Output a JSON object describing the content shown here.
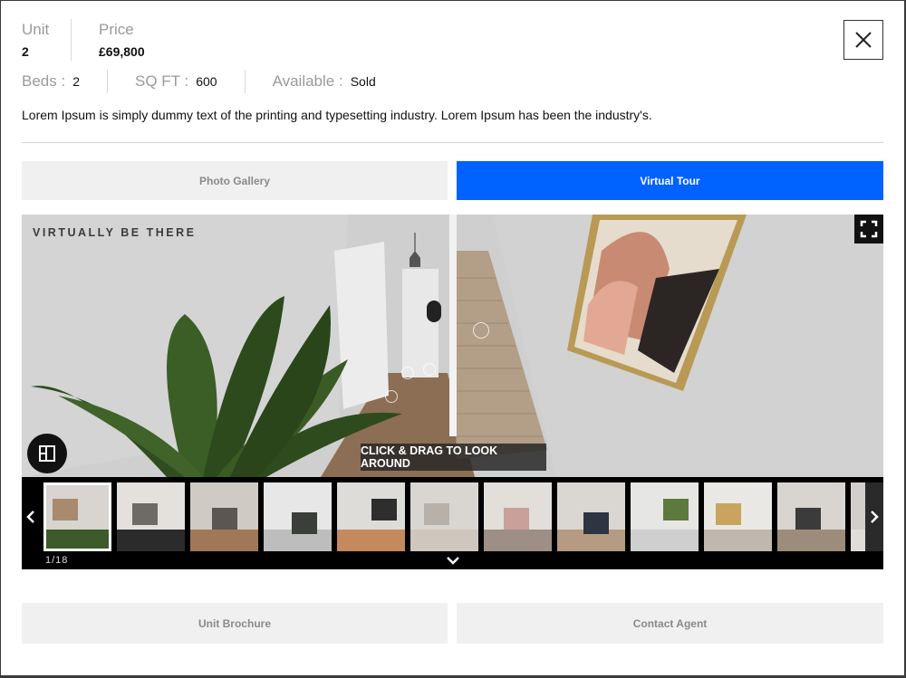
{
  "unit": {
    "label": "Unit",
    "value": "2"
  },
  "price": {
    "label": "Price",
    "value": "£69,800"
  },
  "beds": {
    "label": "Beds :",
    "value": "2"
  },
  "sqft": {
    "label": "SQ FT :",
    "value": "600"
  },
  "available": {
    "label": "Available :",
    "value": "Sold"
  },
  "description": "Lorem Ipsum is simply dummy text of the printing and typesetting industry. Lorem Ipsum has been the industry's.",
  "tabs": {
    "gallery": "Photo Gallery",
    "tour": "Virtual Tour",
    "active": "tour"
  },
  "viewer": {
    "watermark": "VIRTUALLY BE THERE",
    "drag_hint": "CLICK & DRAG TO LOOK AROUND",
    "counter": "1/18"
  },
  "thumbnails": [
    {
      "scene": "hallway-stairs"
    },
    {
      "scene": "living-room-ceiling-light"
    },
    {
      "scene": "living-room-sofa"
    },
    {
      "scene": "kitchen"
    },
    {
      "scene": "hall-mirror"
    },
    {
      "scene": "hall-doorway"
    },
    {
      "scene": "bedroom-pink"
    },
    {
      "scene": "bedroom-double"
    },
    {
      "scene": "bathroom-window"
    },
    {
      "scene": "bathroom-round-mirror"
    },
    {
      "scene": "bedroom-grey"
    },
    {
      "scene": "bedroom-partial"
    }
  ],
  "buttons": {
    "brochure": "Unit Brochure",
    "agent": "Contact Agent"
  },
  "colors": {
    "accent": "#0062ff",
    "tab_inactive": "#f1f0f0"
  },
  "icons": {
    "close": "close-icon",
    "fullscreen": "fullscreen-icon",
    "floorplan": "floorplan-icon"
  }
}
